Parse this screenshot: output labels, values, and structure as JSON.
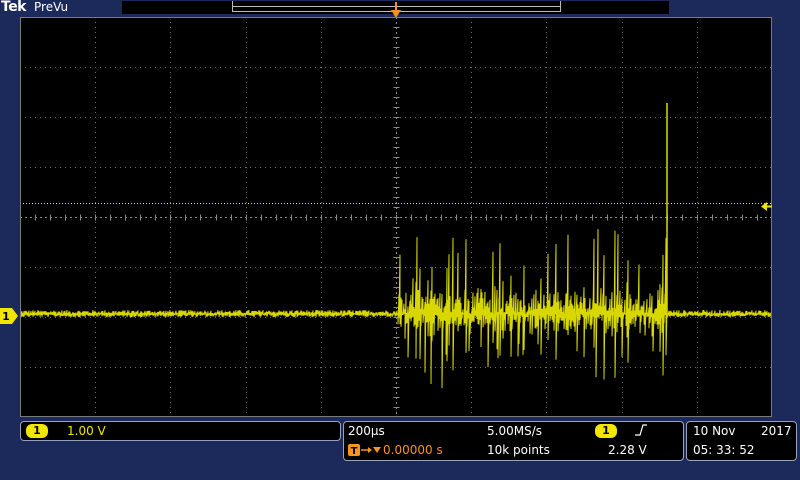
{
  "app": {
    "brand": "Tek",
    "acquisition_state": "PreVu"
  },
  "trigger": {
    "marker_label": "T",
    "position_readout": "0.00000 s",
    "level": "2.28 V",
    "source": "1"
  },
  "channel1": {
    "label": "1",
    "scale": "1.00 V",
    "color": "#f2e600"
  },
  "horizontal": {
    "time_per_div": "200µs",
    "sample_rate": "5.00MS/s",
    "record_length": "10k points"
  },
  "datetime": {
    "date": "10 Nov",
    "year": "2017",
    "time": "05: 33: 52"
  },
  "colors": {
    "trace": "#d8d800",
    "trigger": "#f7931e",
    "frame": "#1b2a5a",
    "graticule": "#6e6e6e"
  },
  "icons": {
    "trigger_arrow": "arrow-right-icon",
    "trigger_slope": "rising-edge-icon",
    "level_marker": "triangle-left-icon"
  }
}
